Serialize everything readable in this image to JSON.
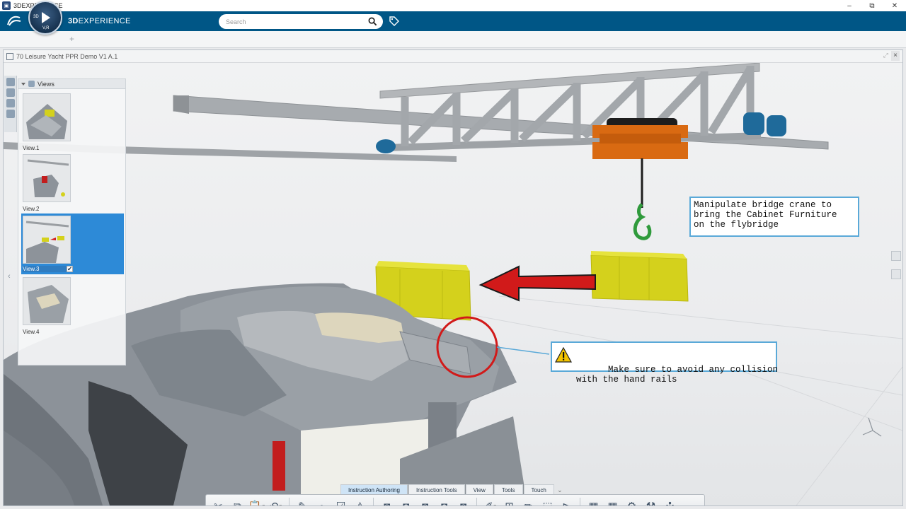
{
  "os": {
    "title": "3DEXPERIENCE",
    "minimize": "–",
    "restore": "⧉",
    "close": "✕"
  },
  "app": {
    "brand_bold": "3D",
    "brand_rest": "EXPERIENCE",
    "compass_3d": "3D",
    "compass_vr": "V,R",
    "search_placeholder": "Search",
    "add_tab": "+",
    "accent": "#005686"
  },
  "document": {
    "title": "70 Leisure Yacht PPR Demo V1 A.1",
    "close": "×"
  },
  "views_panel": {
    "header": "Views",
    "items": [
      {
        "label": "View.1",
        "selected": false
      },
      {
        "label": "View.2",
        "selected": false
      },
      {
        "label": "View.3",
        "selected": true,
        "checked": "✔"
      },
      {
        "label": "View.4",
        "selected": false
      }
    ],
    "collapse": "‹"
  },
  "annotations": {
    "crane_note": "Manipulate bridge crane to\nbring the Cabinet Furniture\non the flybridge",
    "warning_note": "Make sure to avoid any collision\nwith the hand rails",
    "warning_icon": "warning-icon",
    "border_color": "#5aa9d8"
  },
  "toolbar": {
    "tabs": [
      "Instruction Authoring",
      "Instruction Tools",
      "View",
      "Tools",
      "Touch"
    ],
    "active_tab": "Instruction Authoring",
    "more": "⌄"
  },
  "colors": {
    "cabinet": "#d4d11c",
    "arrow": "#d11a1a",
    "crane_trolley": "#d96a12",
    "hook": "#2f9a3c",
    "motor": "#1f6a9a",
    "collision_circle": "#d11a1a"
  }
}
